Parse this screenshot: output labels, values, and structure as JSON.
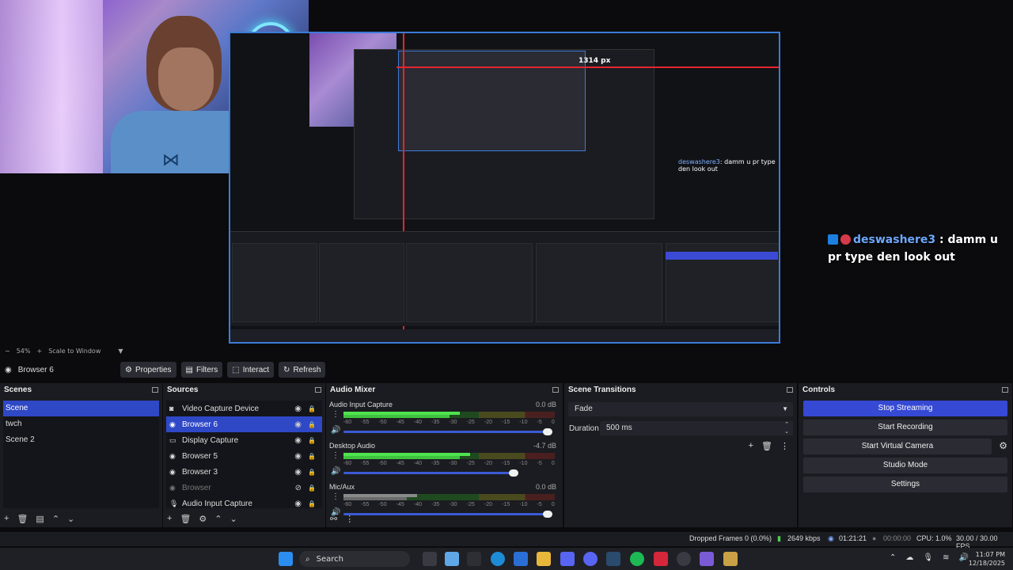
{
  "window": {
    "minimize": "—",
    "maximize": "▢",
    "close": "✕"
  },
  "preview": {
    "nested_px_label": "1314 px",
    "nested_chat_user": "deswashere3",
    "nested_chat_msg": ": damm u pr type den look out"
  },
  "chat": {
    "user": "deswashere3",
    "message": " : damm u pr type den look out"
  },
  "zoom": {
    "minus": "−",
    "percent": "54%",
    "plus": "+",
    "mode": "Scale to Window",
    "arrow": "▼"
  },
  "toolbar": {
    "source_name": "Browser 6",
    "properties": "Properties",
    "filters": "Filters",
    "interact": "Interact",
    "refresh": "Refresh"
  },
  "scenes": {
    "title": "Scenes",
    "items": [
      "Scene",
      "twch",
      "Scene 2"
    ]
  },
  "sources": {
    "title": "Sources",
    "items": [
      {
        "name": "Video Capture Device",
        "icon": "camera-icon"
      },
      {
        "name": "Browser 6",
        "icon": "globe-icon"
      },
      {
        "name": "Display Capture",
        "icon": "monitor-icon"
      },
      {
        "name": "Browser 5",
        "icon": "globe-icon"
      },
      {
        "name": "Browser 3",
        "icon": "globe-icon"
      },
      {
        "name": "Browser",
        "icon": "globe-icon"
      },
      {
        "name": "Audio Input Capture",
        "icon": "mic-icon"
      }
    ]
  },
  "mixer": {
    "title": "Audio Mixer",
    "channels": [
      {
        "name": "Audio Input Capture",
        "db": "0.0 dB",
        "level": 0.55,
        "volume": 0.98
      },
      {
        "name": "Desktop Audio",
        "db": "-4.7 dB",
        "level": 0.6,
        "volume": 0.82
      },
      {
        "name": "Mic/Aux",
        "db": "0.0 dB",
        "level": 0.35,
        "volume": 0.98
      }
    ],
    "ticks": [
      "-60",
      "-55",
      "-50",
      "-45",
      "-40",
      "-35",
      "-30",
      "-25",
      "-20",
      "-15",
      "-10",
      "-5",
      "0"
    ]
  },
  "transitions": {
    "title": "Scene Transitions",
    "selected": "Fade",
    "duration_label": "Duration",
    "duration_value": "500 ms"
  },
  "controls": {
    "title": "Controls",
    "stop_streaming": "Stop Streaming",
    "start_recording": "Start Recording",
    "start_virtual_camera": "Start Virtual Camera",
    "studio_mode": "Studio Mode",
    "settings": "Settings"
  },
  "status": {
    "dropped": "Dropped Frames 0 (0.0%)",
    "kbps": "2649 kbps",
    "stream_time": "01:21:21",
    "rec_time": "00:00:00",
    "cpu": "CPU: 1.0%",
    "fps": "30.00 / 30.00 FPS"
  },
  "taskbar": {
    "search": "Search",
    "time": "11:07 PM",
    "date": "12/18/2025"
  },
  "colors": {
    "accent": "#3549d4",
    "selection": "#2f48c6",
    "red_guide": "#e3262f"
  }
}
